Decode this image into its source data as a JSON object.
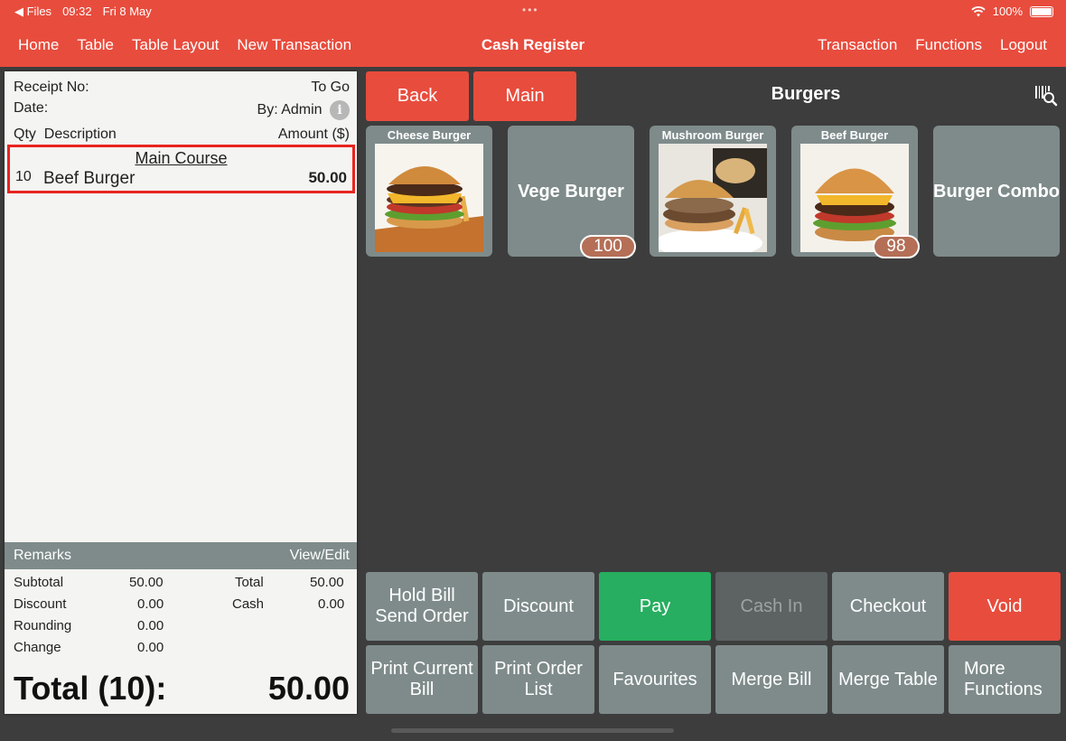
{
  "status_bar": {
    "back_app": "◀ Files",
    "time": "09:32",
    "date": "Fri 8 May",
    "battery": "100%"
  },
  "nav": {
    "left": [
      "Home",
      "Table",
      "Table Layout",
      "New Transaction"
    ],
    "title": "Cash Register",
    "right": [
      "Transaction",
      "Functions",
      "Logout"
    ]
  },
  "receipt": {
    "receipt_no_label": "Receipt No:",
    "order_type": "To Go",
    "date_label": "Date:",
    "by": "By: Admin",
    "col_qty": "Qty",
    "col_desc": "Description",
    "col_amount": "Amount ($)",
    "items": [
      {
        "category": "Main Course",
        "qty": "10",
        "desc": "Beef Burger",
        "amount": "50.00"
      }
    ],
    "remarks_label": "Remarks",
    "view_edit": "View/Edit",
    "subtotal_label": "Subtotal",
    "subtotal": "50.00",
    "discount_label": "Discount",
    "discount": "0.00",
    "rounding_label": "Rounding",
    "rounding": "0.00",
    "change_label": "Change",
    "change": "0.00",
    "total_label": "Total",
    "total": "50.00",
    "cash_label": "Cash",
    "cash": "0.00",
    "grand_total_label": "Total (10):",
    "grand_total": "50.00"
  },
  "category": {
    "back": "Back",
    "main": "Main",
    "title": "Burgers"
  },
  "products": [
    {
      "name": "Cheese Burger",
      "has_image": true,
      "stock": ""
    },
    {
      "name": "Vege Burger",
      "has_image": false,
      "stock": "100"
    },
    {
      "name": "Mushroom Burger",
      "has_image": true,
      "stock": ""
    },
    {
      "name": "Beef Burger",
      "has_image": true,
      "stock": "98"
    },
    {
      "name": "Burger Combo",
      "has_image": false,
      "stock": ""
    }
  ],
  "actions": {
    "hold_bill_line1": "Hold Bill",
    "hold_bill_line2": "Send Order",
    "discount": "Discount",
    "pay": "Pay",
    "cash_in": "Cash In",
    "checkout": "Checkout",
    "void": "Void",
    "print_bill_line1": "Print Current",
    "print_bill_line2": "Bill",
    "print_order_line1": "Print Order",
    "print_order_line2": "List",
    "favourites": "Favourites",
    "merge_bill": "Merge Bill",
    "merge_table": "Merge Table",
    "more_line1": "More",
    "more_line2": "Functions"
  },
  "colors": {
    "accent": "#e84c3d",
    "tile": "#7f8b8b",
    "pay": "#27ae60",
    "background": "#3d3d3d",
    "badge": "#b46f56"
  }
}
